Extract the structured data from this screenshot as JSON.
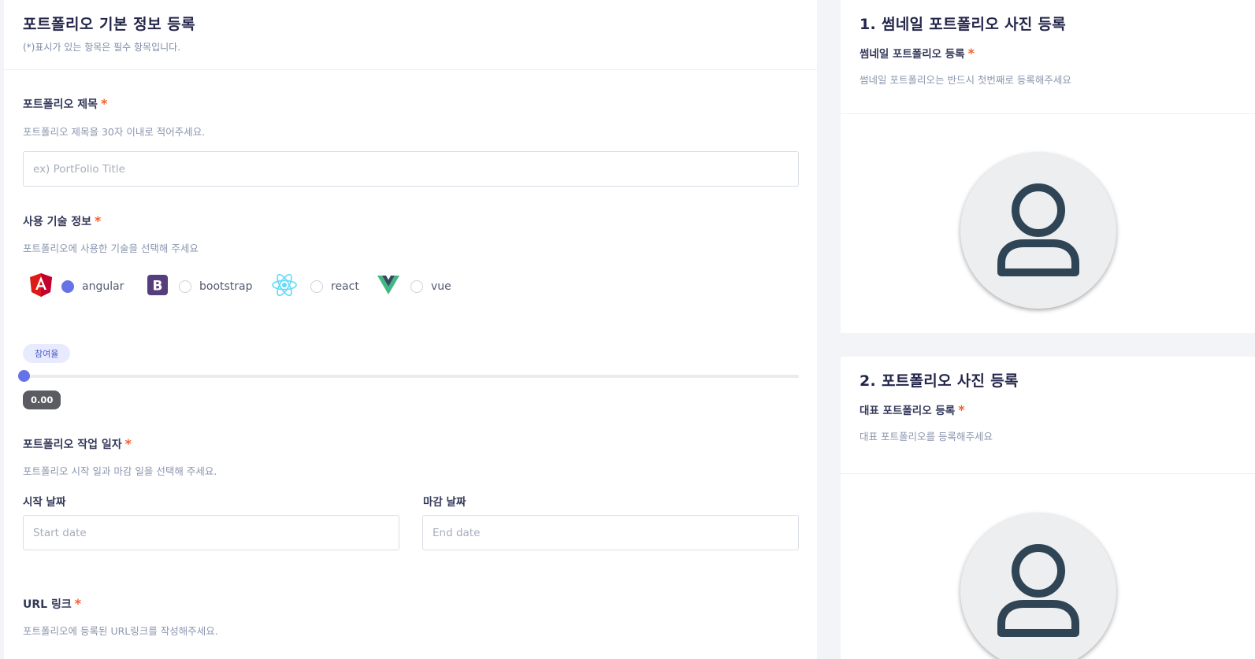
{
  "form": {
    "title": "포트폴리오 기본 정보 등록",
    "subtitle": "(*)표시가 있는 항목은 필수 항목입니다.",
    "required_mark": "*",
    "title_field": {
      "label": "포트폴리오 제목",
      "help": "포트폴리오 제목을 30자 이내로 적어주세요.",
      "placeholder": "ex) PortFolio Title"
    },
    "tech_field": {
      "label": "사용 기술 정보",
      "help": "포트폴리오에 사용한 기술을 선택해 주세요",
      "options": [
        {
          "label": "angular",
          "icon": "angular-icon",
          "selected": true
        },
        {
          "label": "bootstrap",
          "icon": "bootstrap-icon",
          "selected": false
        },
        {
          "label": "react",
          "icon": "react-icon",
          "selected": false
        },
        {
          "label": "vue",
          "icon": "vue-icon",
          "selected": false
        }
      ]
    },
    "participation": {
      "badge": "참여율",
      "value": 0,
      "value_text": "0.00"
    },
    "date_field": {
      "label": "포트폴리오 작업 일자",
      "help": "포트폴리오 시작 일과 마감 일을 선택해 주세요.",
      "start_label": "시작 날짜",
      "start_placeholder": "Start date",
      "end_label": "마감 날짜",
      "end_placeholder": "End date"
    },
    "url_field": {
      "label": "URL 링크",
      "help": "포트폴리오에 등록된 URL링크를 작성해주세요."
    }
  },
  "thumbnail": {
    "title": "1. 썸네일 포트폴리오 사진 등록",
    "label": "썸네일 포트폴리오 등록",
    "help": "썸네일 포트폴리오는 반드시 첫번째로 등록해주세요",
    "icon": "user-icon"
  },
  "photo": {
    "title": "2. 포트폴리오 사진 등록",
    "label": "대표 포트폴리오 등록",
    "help": "대표 포트폴리오를 등록해주세요",
    "icon": "user-icon"
  },
  "colors": {
    "accent": "#6672e6",
    "required": "#f1612f",
    "angular": "#dd1b16",
    "bootstrap": "#563d7c",
    "react": "#61dafb",
    "vue": "#41b883"
  }
}
